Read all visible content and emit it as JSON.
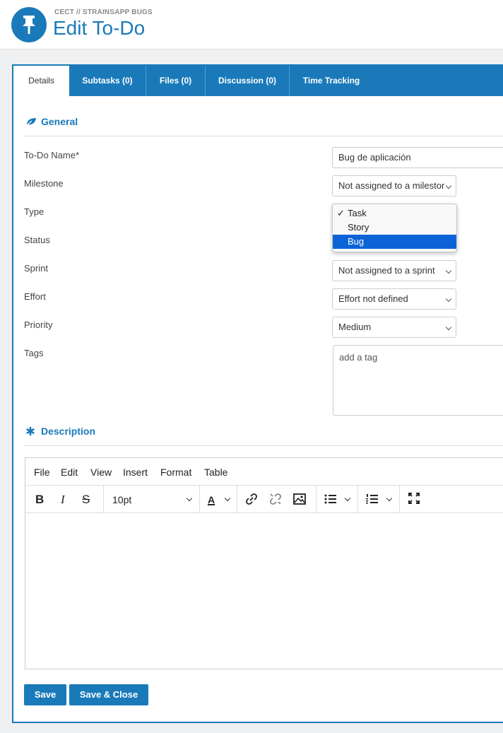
{
  "header": {
    "breadcrumb": "CECT // STRAINSAPP BUGS",
    "title": "Edit To-Do",
    "brand_color": "#1a7ab9",
    "icon": "pushpin-icon"
  },
  "tabs": [
    {
      "label": "Details",
      "active": true
    },
    {
      "label": "Subtasks (0)",
      "active": false
    },
    {
      "label": "Files (0)",
      "active": false
    },
    {
      "label": "Discussion (0)",
      "active": false
    },
    {
      "label": "Time Tracking",
      "active": false
    }
  ],
  "general": {
    "title": "General",
    "icon": "leaf-icon",
    "fields": {
      "name": {
        "label": "To-Do Name*",
        "value": "Bug de aplicación"
      },
      "milestone": {
        "label": "Milestone",
        "value": "Not assigned to a milestone"
      },
      "type": {
        "label": "Type",
        "options": [
          "Task",
          "Story",
          "Bug"
        ],
        "checked": "Task",
        "highlighted": "Bug"
      },
      "status": {
        "label": "Status"
      },
      "sprint": {
        "label": "Sprint",
        "value": "Not assigned to a sprint"
      },
      "effort": {
        "label": "Effort",
        "value": "Effort not defined"
      },
      "priority": {
        "label": "Priority",
        "value": "Medium"
      },
      "tags": {
        "label": "Tags",
        "placeholder": "add a tag"
      }
    }
  },
  "description": {
    "title": "Description",
    "icon": "asterisk-icon",
    "menu": [
      "File",
      "Edit",
      "View",
      "Insert",
      "Format",
      "Table"
    ],
    "font_size": "10pt"
  },
  "buttons": {
    "save": "Save",
    "save_close": "Save & Close"
  }
}
